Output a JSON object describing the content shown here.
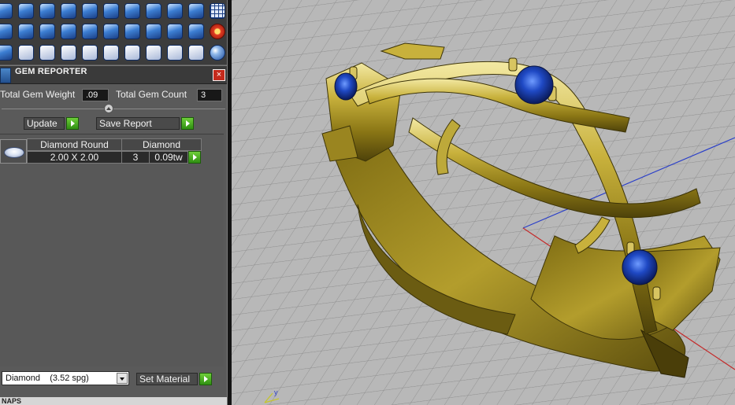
{
  "panel": {
    "title": "GEM REPORTER",
    "close_glyph": "×",
    "total_gem_weight_label": "Total Gem Weight",
    "total_gem_weight_value": ".09",
    "total_gem_count_label": "Total Gem Count",
    "total_gem_count_value": "3",
    "update_label": "Update",
    "save_report_label": "Save Report"
  },
  "gem_table": {
    "headers": [
      "Diamond Round",
      "Diamond"
    ],
    "rows": [
      {
        "size": "2.00 X 2.00",
        "count": "3",
        "weight": "0.09tw"
      }
    ]
  },
  "material": {
    "selected": "Diamond    (3.52 spg)",
    "set_label": "Set Material"
  },
  "snaps_label": "NAPS",
  "toolbar_icons": [
    [
      "curve-circle-icon",
      "freeform-curve-icon",
      "ring-shape-icon",
      "gem-profile-icon",
      "gem-cut-icon",
      "mountain-profile-icon",
      "gem-outline-icon",
      "gem-rotated-icon",
      "shield-gem-icon",
      "gem-group-icon",
      "grid-icon"
    ],
    [
      "rail-curve-icon",
      "square-frame-icon",
      "check-path-icon",
      "gem-cone-icon",
      "curve-arc-icon",
      "cutter-icon",
      "seat-icon",
      "gem-scatter-icon",
      "bezel-icon",
      "gallery-icon",
      "flower-icon"
    ],
    [
      "move-point-icon",
      "rotate-curve-icon",
      "bounding-box-icon",
      "mirror-icon",
      "move-icon",
      "scale-corner-icon",
      "sweep-icon",
      "boolean-icon",
      "split-icon",
      "cut-icon",
      "globe-icon"
    ]
  ],
  "colors": {
    "panel_bg": "#5a5a5a",
    "viewport_bg": "#b7b7b7",
    "gold": "#a9931f",
    "gem_blue": "#1e3fa8",
    "accent_green": "#3aa11a",
    "close_red": "#c42a1c"
  }
}
